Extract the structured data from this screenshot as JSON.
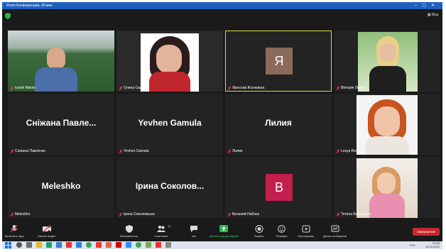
{
  "window": {
    "title": "Zoom Конференция, 40 мин"
  },
  "header": {
    "view_label": "Вид"
  },
  "tiles": [
    {
      "name": "Ivanik Mikola"
    },
    {
      "name": "Олена Сидкова"
    },
    {
      "name": "Ярослав Жалювага",
      "avatar_letter": "Я",
      "avatar_color": "#8a6a5a"
    },
    {
      "name": "Вікторія Лаврук"
    },
    {
      "display": "Сніжана Павле...",
      "name": "Сніжана Павленко"
    },
    {
      "display": "Yevhen Gamula",
      "name": "Yevhen Gamula"
    },
    {
      "display": "Лилия",
      "name": "Лилия"
    },
    {
      "name": "Lesya Revbi"
    },
    {
      "display": "Meleshko",
      "name": "Meleshko"
    },
    {
      "display": "Ірина Соколов...",
      "name": "Ірина Соколовська"
    },
    {
      "name": "Виталий Набока",
      "avatar_letter": "В",
      "avatar_color": "#c21f4e"
    },
    {
      "name": "Тетяна Бараненко"
    }
  ],
  "toolbar": {
    "unmute": "Включить звук",
    "start_video": "Начать видео",
    "security": "Безопасность",
    "participants": "Участники",
    "participants_count": "12",
    "chat": "Чат",
    "share": "Демонстрация экрана",
    "record": "Запись",
    "reactions": "Реакции",
    "apps": "Приложения",
    "whiteboards": "Доски сообщений",
    "end": "Завершение"
  },
  "taskbar": {
    "time": "20:53",
    "date": "19.10.2022",
    "lang": "РУС"
  }
}
